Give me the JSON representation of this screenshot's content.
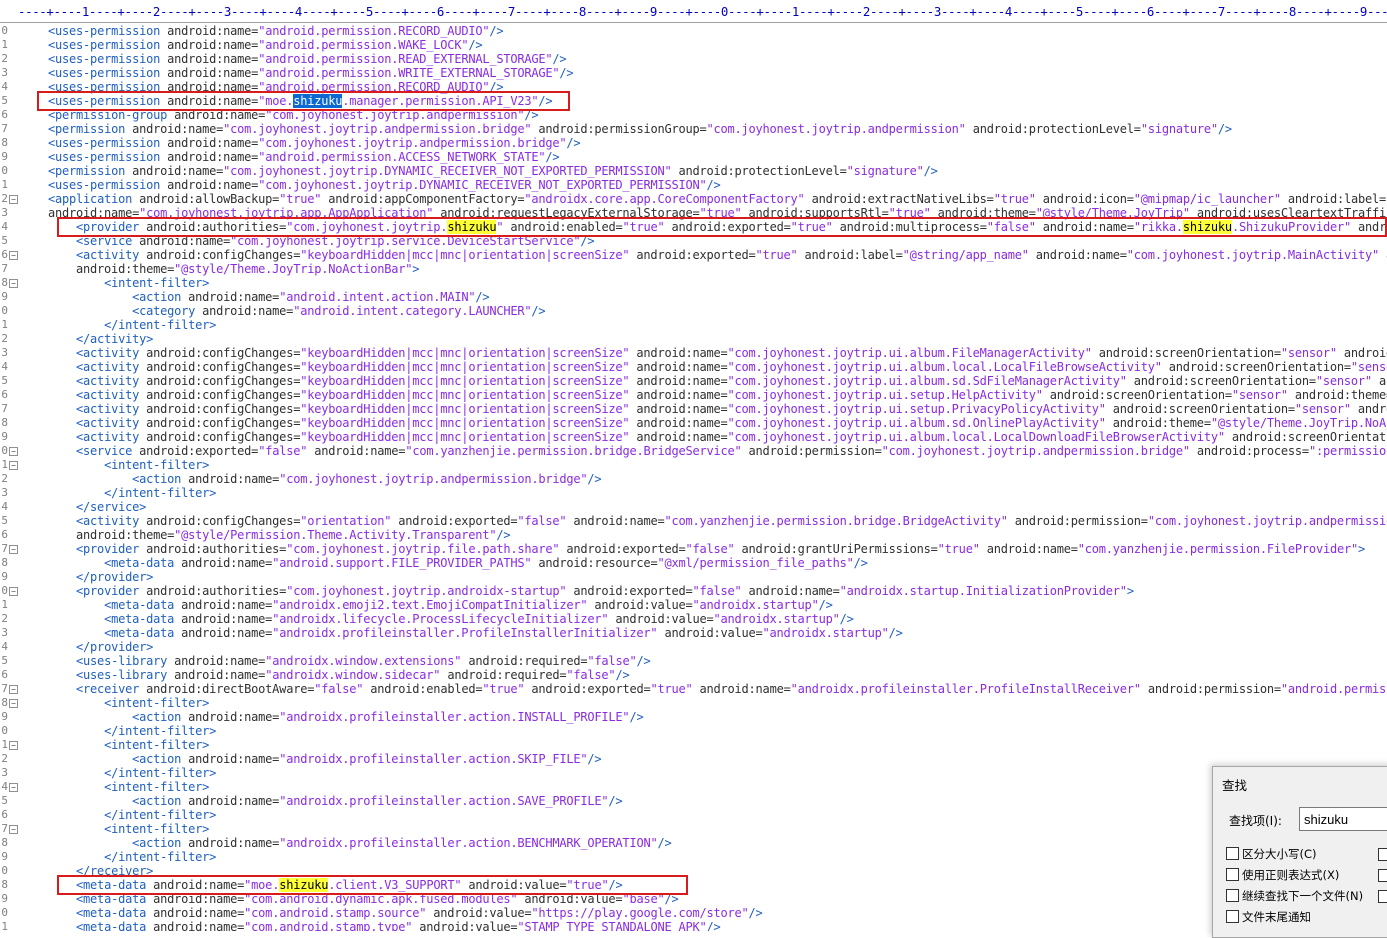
{
  "ruler": "----+----1----+----2----+----3----+----4----+----5----+----6----+----7----+----8----+----9----+----0----+----1----+----2----+----3----+----4----+----5----+----6----+----7----+----8----+----9----+",
  "lines": [
    {
      "n": "0",
      "f": "",
      "code": "    <uses-permission android:name=\"android.permission.RECORD_AUDIO\"/>"
    },
    {
      "n": "1",
      "f": "",
      "code": "    <uses-permission android:name=\"android.permission.WAKE_LOCK\"/>"
    },
    {
      "n": "2",
      "f": "",
      "code": "    <uses-permission android:name=\"android.permission.READ_EXTERNAL_STORAGE\"/>"
    },
    {
      "n": "3",
      "f": "",
      "code": "    <uses-permission android:name=\"android.permission.WRITE_EXTERNAL_STORAGE\"/>"
    },
    {
      "n": "4",
      "f": "",
      "code": "    <uses-permission android:name=\"android.permission.RECORD_AUDIO\"/>"
    },
    {
      "n": "5",
      "f": "",
      "code": "    <uses-permission android:name=\"moe.[[shizuku]].manager.permission.API_V23\"/>"
    },
    {
      "n": "6",
      "f": "",
      "code": "    <permission-group android:name=\"com.joyhonest.joytrip.andpermission\"/>"
    },
    {
      "n": "7",
      "f": "",
      "code": "    <permission android:name=\"com.joyhonest.joytrip.andpermission.bridge\" android:permissionGroup=\"com.joyhonest.joytrip.andpermission\" android:protectionLevel=\"signature\"/>"
    },
    {
      "n": "8",
      "f": "",
      "code": "    <uses-permission android:name=\"com.joyhonest.joytrip.andpermission.bridge\"/>"
    },
    {
      "n": "9",
      "f": "",
      "code": "    <uses-permission android:name=\"android.permission.ACCESS_NETWORK_STATE\"/>"
    },
    {
      "n": "0",
      "f": "",
      "code": "    <permission android:name=\"com.joyhonest.joytrip.DYNAMIC_RECEIVER_NOT_EXPORTED_PERMISSION\" android:protectionLevel=\"signature\"/>"
    },
    {
      "n": "1",
      "f": "",
      "code": "    <uses-permission android:name=\"com.joyhonest.joytrip.DYNAMIC_RECEIVER_NOT_EXPORTED_PERMISSION\"/>"
    },
    {
      "n": "2",
      "f": "⊟",
      "code": "    <application android:allowBackup=\"true\" android:appComponentFactory=\"androidx.core.app.CoreComponentFactory\" android:extractNativeLibs=\"true\" android:icon=\"@mipmap/ic_launcher\" android:label=\"@string/app_name\""
    },
    {
      "n": "3",
      "f": "",
      "code": "    android:name=\"com.joyhonest.joytrip.app.AppApplication\" android:requestLegacyExternalStorage=\"true\" android:supportsRtl=\"true\" android:theme=\"@style/Theme.JoyTrip\" android:usesCleartextTraffic=\"true\">"
    },
    {
      "n": "4",
      "f": "",
      "code": "        <provider android:authorities=\"com.joyhonest.joytrip.{{shizuku}}\" android:enabled=\"true\" android:exported=\"true\" android:multiprocess=\"false\" android:name=\"rikka.{{shizuku}}.ShizukuProvider\" android:permission=\"android.permission.INTERACT_ACROSS_USERS_FULL\"/>"
    },
    {
      "n": "5",
      "f": "",
      "code": "        <service android:name=\"com.joyhonest.joytrip.service.DeviceStartService\"/>"
    },
    {
      "n": "6",
      "f": "⊟",
      "code": "        <activity android:configChanges=\"keyboardHidden|mcc|mnc|orientation|screenSize\" android:exported=\"true\" android:label=\"@string/app_name\" android:name=\"com.joyhonest.joytrip.MainActivity\" android:screenOrientation=\"sensor\""
    },
    {
      "n": "7",
      "f": "",
      "code": "        android:theme=\"@style/Theme.JoyTrip.NoActionBar\">"
    },
    {
      "n": "8",
      "f": "⊟",
      "code": "            <intent-filter>"
    },
    {
      "n": "9",
      "f": "",
      "code": "                <action android:name=\"android.intent.action.MAIN\"/>"
    },
    {
      "n": "0",
      "f": "",
      "code": "                <category android:name=\"android.intent.category.LAUNCHER\"/>"
    },
    {
      "n": "1",
      "f": "",
      "code": "            </intent-filter>"
    },
    {
      "n": "2",
      "f": "",
      "code": "        </activity>"
    },
    {
      "n": "3",
      "f": "",
      "code": "        <activity android:configChanges=\"keyboardHidden|mcc|mnc|orientation|screenSize\" android:name=\"com.joyhonest.joytrip.ui.album.FileManagerActivity\" android:screenOrientation=\"sensor\" android:theme=\"@style/Theme.JoyTrip.NoActionBar\"/>"
    },
    {
      "n": "4",
      "f": "",
      "code": "        <activity android:configChanges=\"keyboardHidden|mcc|mnc|orientation|screenSize\" android:name=\"com.joyhonest.joytrip.ui.album.local.LocalFileBrowseActivity\" android:screenOrientation=\"sensor\" android:theme=\"@style/Theme.JoyTrip.NoActionBar\"/>"
    },
    {
      "n": "5",
      "f": "",
      "code": "        <activity android:configChanges=\"keyboardHidden|mcc|mnc|orientation|screenSize\" android:name=\"com.joyhonest.joytrip.ui.album.sd.SdFileManagerActivity\" android:screenOrientation=\"sensor\" android:theme=\"@style/Theme.JoyTrip.NoActionBar\"/>"
    },
    {
      "n": "6",
      "f": "",
      "code": "        <activity android:configChanges=\"keyboardHidden|mcc|mnc|orientation|screenSize\" android:name=\"com.joyhonest.joytrip.ui.setup.HelpActivity\" android:screenOrientation=\"sensor\" android:theme=\"@style/Theme.JoyTrip.NoActionBar\"/>"
    },
    {
      "n": "7",
      "f": "",
      "code": "        <activity android:configChanges=\"keyboardHidden|mcc|mnc|orientation|screenSize\" android:name=\"com.joyhonest.joytrip.ui.setup.PrivacyPolicyActivity\" android:screenOrientation=\"sensor\" android:theme=\"@style/Theme.JoyTrip.NoActionBar\"/>"
    },
    {
      "n": "8",
      "f": "",
      "code": "        <activity android:configChanges=\"keyboardHidden|mcc|mnc|orientation|screenSize\" android:name=\"com.joyhonest.joytrip.ui.album.sd.OnlinePlayActivity\" android:theme=\"@style/Theme.JoyTrip.NoActionBar\"/>"
    },
    {
      "n": "9",
      "f": "",
      "code": "        <activity android:configChanges=\"keyboardHidden|mcc|mnc|orientation|screenSize\" android:name=\"com.joyhonest.joytrip.ui.album.local.LocalDownloadFileBrowserActivity\" android:screenOrientation=\"sensor\"/>"
    },
    {
      "n": "0",
      "f": "⊟",
      "code": "        <service android:exported=\"false\" android:name=\"com.yanzhenjie.permission.bridge.BridgeService\" android:permission=\"com.joyhonest.joytrip.andpermission.bridge\" android:process=\":permission\">"
    },
    {
      "n": "1",
      "f": "⊟",
      "code": "            <intent-filter>"
    },
    {
      "n": "2",
      "f": "",
      "code": "                <action android:name=\"com.joyhonest.joytrip.andpermission.bridge\"/>"
    },
    {
      "n": "3",
      "f": "",
      "code": "            </intent-filter>"
    },
    {
      "n": "4",
      "f": "",
      "code": "        </service>"
    },
    {
      "n": "5",
      "f": "",
      "code": "        <activity android:configChanges=\"orientation\" android:exported=\"false\" android:name=\"com.yanzhenjie.permission.bridge.BridgeActivity\" android:permission=\"com.joyhonest.joytrip.andpermission.bridge\""
    },
    {
      "n": "6",
      "f": "",
      "code": "        android:theme=\"@style/Permission.Theme.Activity.Transparent\"/>"
    },
    {
      "n": "7",
      "f": "⊟",
      "code": "        <provider android:authorities=\"com.joyhonest.joytrip.file.path.share\" android:exported=\"false\" android:grantUriPermissions=\"true\" android:name=\"com.yanzhenjie.permission.FileProvider\">"
    },
    {
      "n": "8",
      "f": "",
      "code": "            <meta-data android:name=\"android.support.FILE_PROVIDER_PATHS\" android:resource=\"@xml/permission_file_paths\"/>"
    },
    {
      "n": "9",
      "f": "",
      "code": "        </provider>"
    },
    {
      "n": "0",
      "f": "⊟",
      "code": "        <provider android:authorities=\"com.joyhonest.joytrip.androidx-startup\" android:exported=\"false\" android:name=\"androidx.startup.InitializationProvider\">"
    },
    {
      "n": "1",
      "f": "",
      "code": "            <meta-data android:name=\"androidx.emoji2.text.EmojiCompatInitializer\" android:value=\"androidx.startup\"/>"
    },
    {
      "n": "2",
      "f": "",
      "code": "            <meta-data android:name=\"androidx.lifecycle.ProcessLifecycleInitializer\" android:value=\"androidx.startup\"/>"
    },
    {
      "n": "3",
      "f": "",
      "code": "            <meta-data android:name=\"androidx.profileinstaller.ProfileInstallerInitializer\" android:value=\"androidx.startup\"/>"
    },
    {
      "n": "4",
      "f": "",
      "code": "        </provider>"
    },
    {
      "n": "5",
      "f": "",
      "code": "        <uses-library android:name=\"androidx.window.extensions\" android:required=\"false\"/>"
    },
    {
      "n": "6",
      "f": "",
      "code": "        <uses-library android:name=\"androidx.window.sidecar\" android:required=\"false\"/>"
    },
    {
      "n": "7",
      "f": "⊟",
      "code": "        <receiver android:directBootAware=\"false\" android:enabled=\"true\" android:exported=\"true\" android:name=\"androidx.profileinstaller.ProfileInstallReceiver\" android:permission=\"android.permission.DUMP\">"
    },
    {
      "n": "8",
      "f": "⊟",
      "code": "            <intent-filter>"
    },
    {
      "n": "9",
      "f": "",
      "code": "                <action android:name=\"androidx.profileinstaller.action.INSTALL_PROFILE\"/>"
    },
    {
      "n": "0",
      "f": "",
      "code": "            </intent-filter>"
    },
    {
      "n": "1",
      "f": "⊟",
      "code": "            <intent-filter>"
    },
    {
      "n": "2",
      "f": "",
      "code": "                <action android:name=\"androidx.profileinstaller.action.SKIP_FILE\"/>"
    },
    {
      "n": "3",
      "f": "",
      "code": "            </intent-filter>"
    },
    {
      "n": "4",
      "f": "⊟",
      "code": "            <intent-filter>"
    },
    {
      "n": "5",
      "f": "",
      "code": "                <action android:name=\"androidx.profileinstaller.action.SAVE_PROFILE\"/>"
    },
    {
      "n": "6",
      "f": "",
      "code": "            </intent-filter>"
    },
    {
      "n": "7",
      "f": "⊟",
      "code": "            <intent-filter>"
    },
    {
      "n": "8",
      "f": "",
      "code": "                <action android:name=\"androidx.profileinstaller.action.BENCHMARK_OPERATION\"/>"
    },
    {
      "n": "9",
      "f": "",
      "code": "            </intent-filter>"
    },
    {
      "n": "0",
      "f": "",
      "code": "        </receiver>"
    },
    {
      "n": "8",
      "f": "",
      "code": "        <meta-data android:name=\"moe.{{shizuku}}.client.V3_SUPPORT\" android:value=\"true\"/>"
    },
    {
      "n": "9",
      "f": "",
      "code": "        <meta-data android:name=\"com.android.dynamic.apk.fused.modules\" android:value=\"base\"/>"
    },
    {
      "n": "0",
      "f": "",
      "code": "        <meta-data android:name=\"com.android.stamp.source\" android:value=\"https://play.google.com/store\"/>"
    },
    {
      "n": "1",
      "f": "",
      "code": "        <meta-data android:name=\"com.android.stamp.type\" android:value=\"STAMP_TYPE_STANDALONE_APK\"/>"
    }
  ],
  "highlighted_lines": [
    5,
    14,
    61
  ],
  "find_dialog": {
    "title": "查找",
    "find_label": "查找项(I):",
    "find_value": "shizuku",
    "options": [
      {
        "label": "区分大小写(C)",
        "checked": false
      },
      {
        "label": "使用正则表达式(X)",
        "checked": false
      },
      {
        "label": "继续查找下一个文件(N)",
        "checked": false
      },
      {
        "label": "文件末尾通知",
        "checked": false
      }
    ]
  },
  "colors": {
    "highlight_match": "#ffff38",
    "current_match": "#0a6ad1",
    "red_box": "#d81b1b",
    "tag": "#1f5fbf",
    "value": "#8a2be2"
  }
}
